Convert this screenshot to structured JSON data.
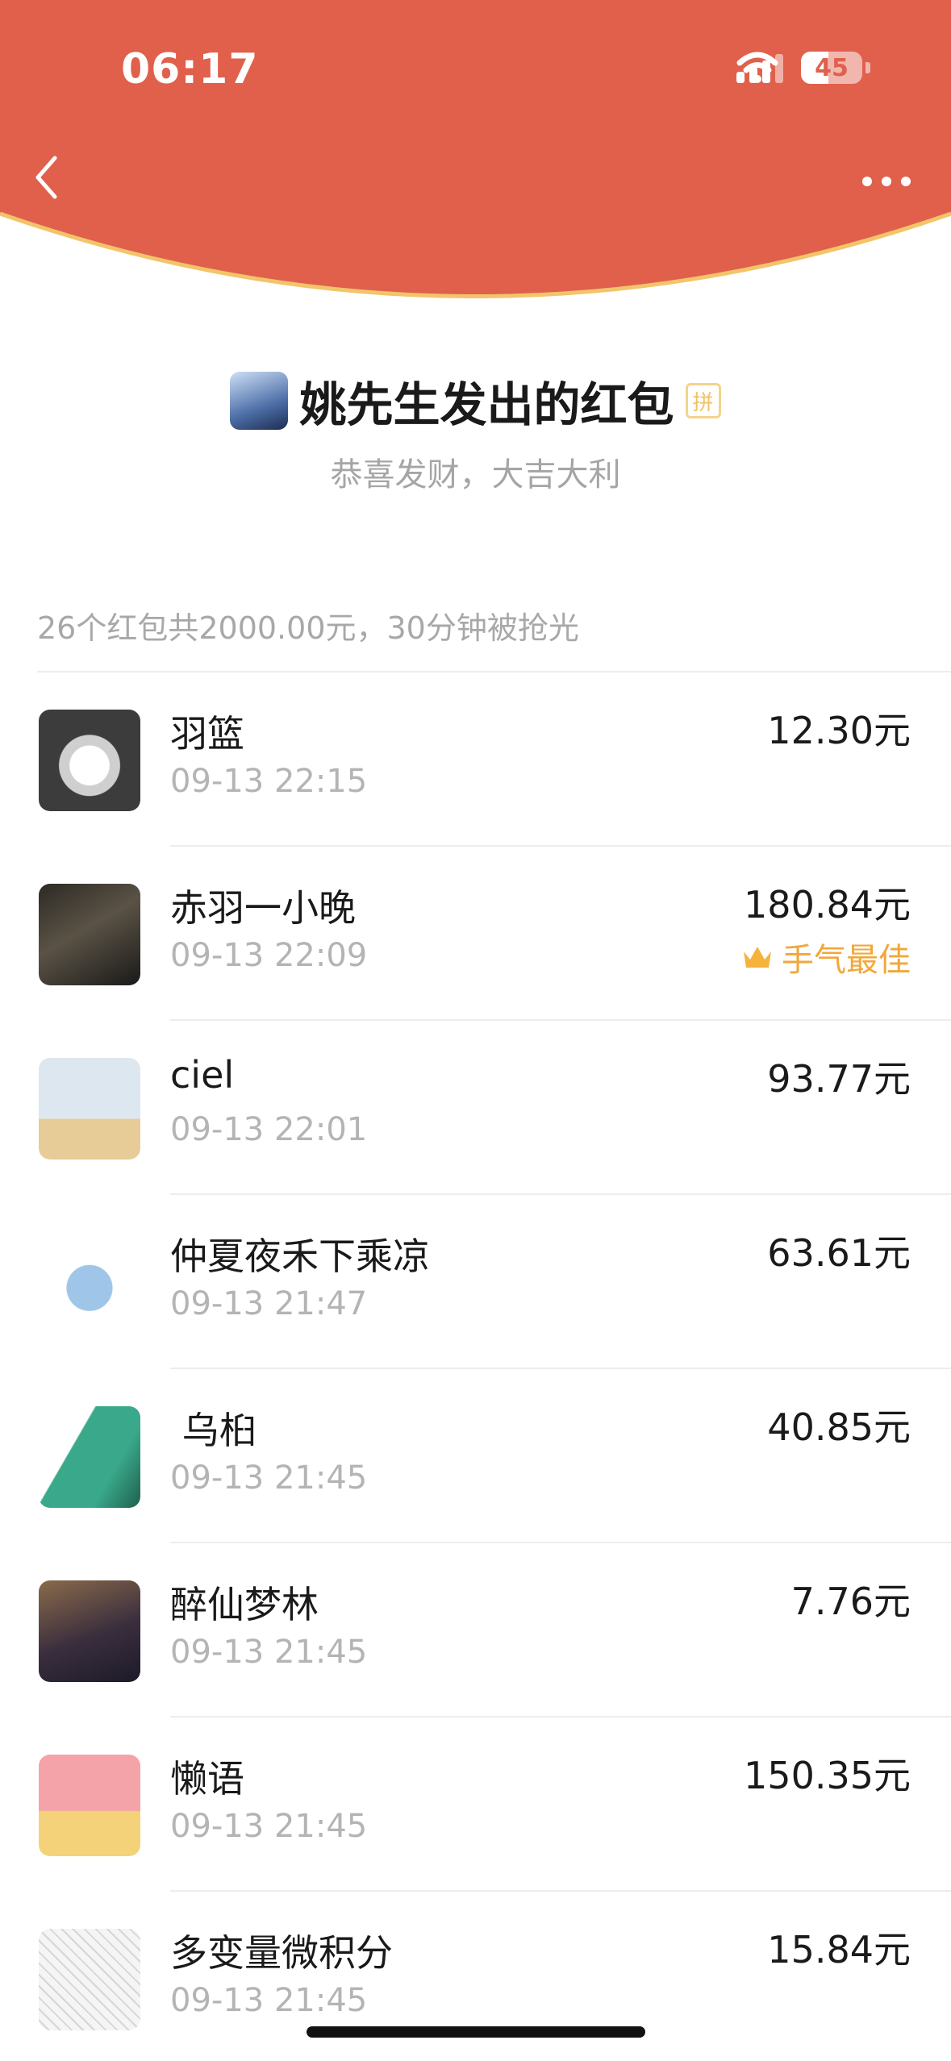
{
  "status_bar": {
    "time": "06:17",
    "battery_level": "45"
  },
  "header": {
    "background_color": "#e0604c",
    "border_color": "#f2c56a"
  },
  "sender": {
    "title": "姚先生发出的红包",
    "badge": "拼",
    "greeting": "恭喜发财，大吉大利"
  },
  "summary": "26个红包共2000.00元，30分钟被抢光",
  "claims": [
    {
      "name": "羽篮",
      "time": "09-13 22:15",
      "amount": "12.30元",
      "best_label": ""
    },
    {
      "name": "赤羽一小晚",
      "time": "09-13 22:09",
      "amount": "180.84元",
      "best_label": "手气最佳"
    },
    {
      "name": "ciel",
      "time": "09-13 22:01",
      "amount": "93.77元",
      "best_label": ""
    },
    {
      "name": "仲夏夜禾下乘凉",
      "time": "09-13 21:47",
      "amount": "63.61元",
      "best_label": ""
    },
    {
      "name": " 乌桕",
      "time": "09-13 21:45",
      "amount": "40.85元",
      "best_label": ""
    },
    {
      "name": "醉仙梦林",
      "time": "09-13 21:45",
      "amount": "7.76元",
      "best_label": ""
    },
    {
      "name": "懒语",
      "time": "09-13 21:45",
      "amount": "150.35元",
      "best_label": ""
    },
    {
      "name": "多变量微积分",
      "time": "09-13 21:45",
      "amount": "15.84元",
      "best_label": ""
    }
  ],
  "colors": {
    "best_label": "#f2a73a",
    "muted_text": "#a8a8a8"
  },
  "icons": {
    "back": "chevron-left-icon",
    "more": "more-dots-icon",
    "best": "crown-icon"
  }
}
